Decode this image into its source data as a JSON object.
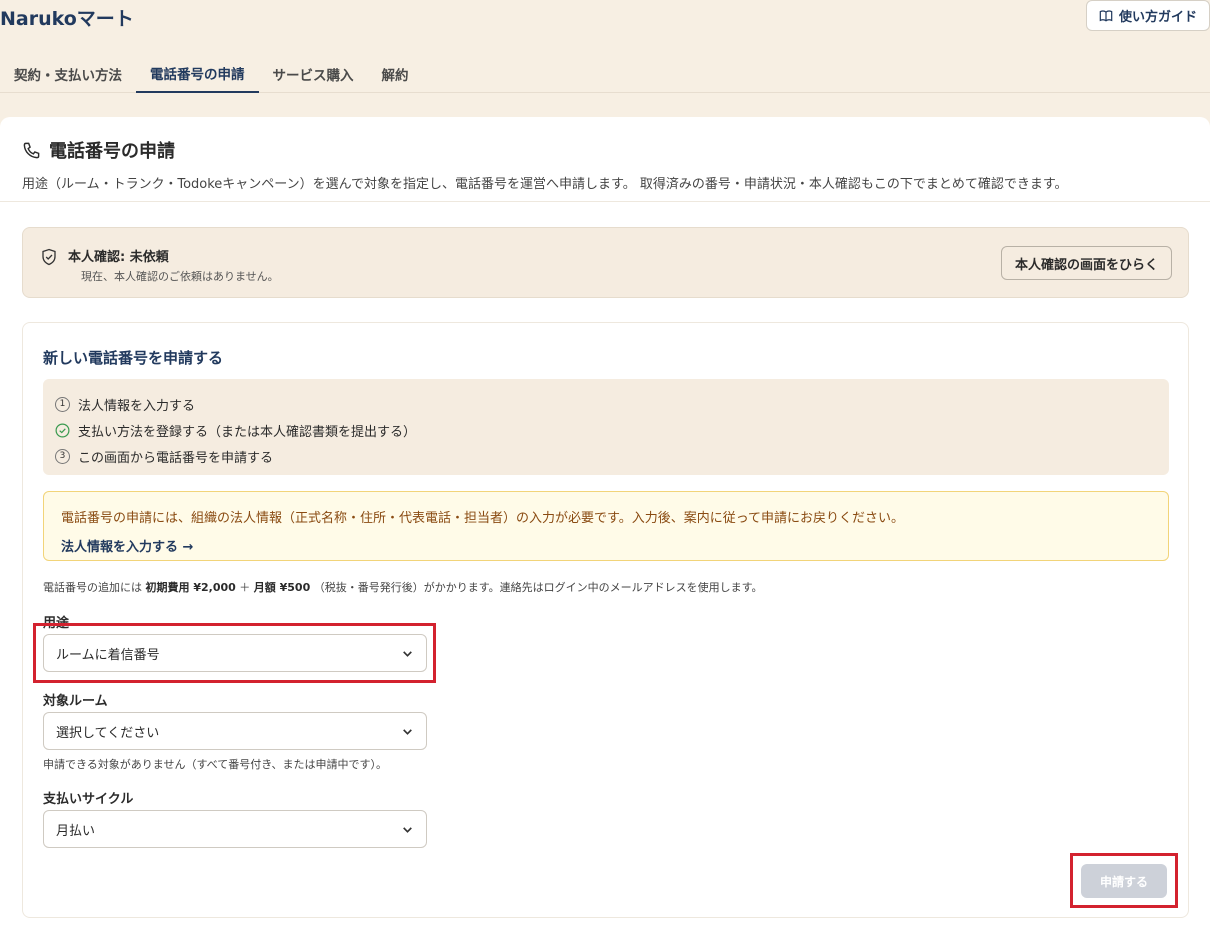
{
  "app": {
    "brand": "Narukoマート",
    "guide_label": "使い方ガイド"
  },
  "tabs": [
    {
      "label": "契約・支払い方法"
    },
    {
      "label": "電話番号の申請",
      "active": true
    },
    {
      "label": "サービス購入"
    },
    {
      "label": "解約"
    }
  ],
  "page": {
    "title": "電話番号の申請",
    "description": "用途（ルーム・トランク・Todokeキャンペーン）を選んで対象を指定し、電話番号を運営へ申請します。 取得済みの番号・申請状況・本人確認もこの下でまとめて確認できます。"
  },
  "verification": {
    "title": "本人確認: 未依頼",
    "subtitle": "現在、本人確認のご依頼はありません。",
    "button_label": "本人確認の画面をひらく"
  },
  "form": {
    "title": "新しい電話番号を申請する",
    "steps": [
      {
        "marker": "1",
        "label": "法人情報を入力する"
      },
      {
        "marker": "check",
        "label": "支払い方法を登録する（または本人確認書類を提出する）"
      },
      {
        "marker": "3",
        "label": "この画面から電話番号を申請する"
      }
    ],
    "notice": {
      "text": "電話番号の申請には、組織の法人情報（正式名称・住所・代表電話・担当者）の入力が必要です。入力後、案内に従って申請にお戻りください。",
      "link": "法人情報を入力する →"
    },
    "fee": {
      "prefix": "電話番号の追加には ",
      "initial": "初期費用 ¥2,000",
      "plus": " ＋ ",
      "monthly": "月額 ¥500",
      "suffix": " （税抜・番号発行後）がかかります。連絡先はログイン中のメールアドレスを使用します。"
    },
    "purpose": {
      "label": "用途",
      "value": "ルームに着信番号"
    },
    "target_room": {
      "label": "対象ルーム",
      "value": "選択してください",
      "help": "申請できる対象がありません（すべて番号付き、または申請中です）。"
    },
    "billing_cycle": {
      "label": "支払いサイクル",
      "value": "月払い"
    },
    "submit_label": "申請する"
  },
  "colors": {
    "accent": "#223a5e",
    "highlight": "#d3222f",
    "panel_bg": "#f7efe3"
  }
}
